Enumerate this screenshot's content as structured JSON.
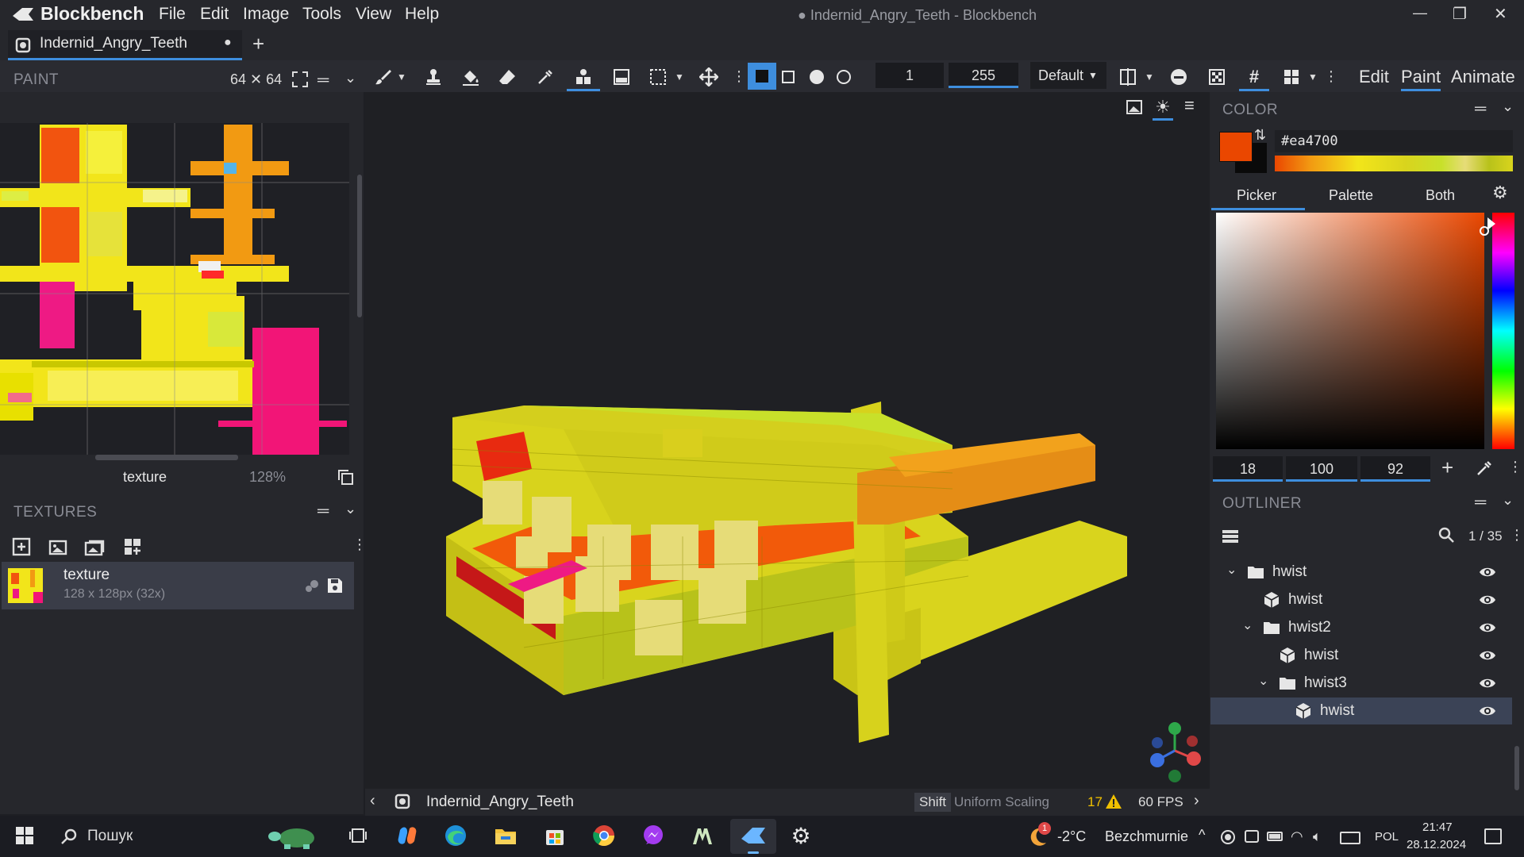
{
  "app": {
    "name": "Blockbench",
    "window_title": "● Indernid_Angry_Teeth - Blockbench"
  },
  "menu": [
    "File",
    "Edit",
    "Image",
    "Tools",
    "View",
    "Help"
  ],
  "tab": {
    "name": "Indernid_Angry_Teeth",
    "dot": "●",
    "add": "+"
  },
  "window_controls": {
    "minimize": "—",
    "maximize": "❐",
    "close": "✕"
  },
  "paint_panel": {
    "title": "PAINT",
    "size": "64 ✕ 64",
    "texture_label": "texture",
    "zoom": "128%"
  },
  "toolbar": {
    "brush_size": "1",
    "opacity": "255",
    "blend_mode": "Default"
  },
  "modes": {
    "edit": "Edit",
    "paint": "Paint",
    "animate": "Animate",
    "active": "Paint"
  },
  "textures_panel": {
    "title": "TEXTURES",
    "items": [
      {
        "name": "texture",
        "info": "128 x 128px (32x)"
      }
    ]
  },
  "color_panel": {
    "title": "COLOR",
    "hex": "#ea4700",
    "tabs": [
      "Picker",
      "Palette",
      "Both"
    ],
    "active_tab": "Picker",
    "h": "18",
    "s": "100",
    "v": "92",
    "main_color": "#ea4700"
  },
  "outliner": {
    "title": "OUTLINER",
    "count": "1 / 35",
    "rows": [
      {
        "type": "folder",
        "label": "hwist",
        "depth": 0,
        "expanded": true
      },
      {
        "type": "cube",
        "label": "hwist",
        "depth": 1
      },
      {
        "type": "folder",
        "label": "hwist2",
        "depth": 1,
        "expanded": true
      },
      {
        "type": "cube",
        "label": "hwist",
        "depth": 2
      },
      {
        "type": "folder",
        "label": "hwist3",
        "depth": 2,
        "expanded": true
      },
      {
        "type": "cube",
        "label": "hwist",
        "depth": 3,
        "selected": true
      }
    ]
  },
  "status_bar": {
    "project": "Indernid_Angry_Teeth",
    "key": "Shift",
    "hint": "Uniform Scaling",
    "warnings": "17",
    "fps": "60 FPS"
  },
  "taskbar": {
    "search": "Пошук",
    "weather_temp": "-2°C",
    "weather_desc": "Bezchmurnie",
    "badge": "1",
    "lang": "POL",
    "time": "21:47",
    "date": "28.12.2024"
  },
  "colors": {
    "accent": "#3e8ede",
    "bg": "#1e1f24",
    "panel": "#26272c",
    "selected_row": "#3b4356"
  }
}
